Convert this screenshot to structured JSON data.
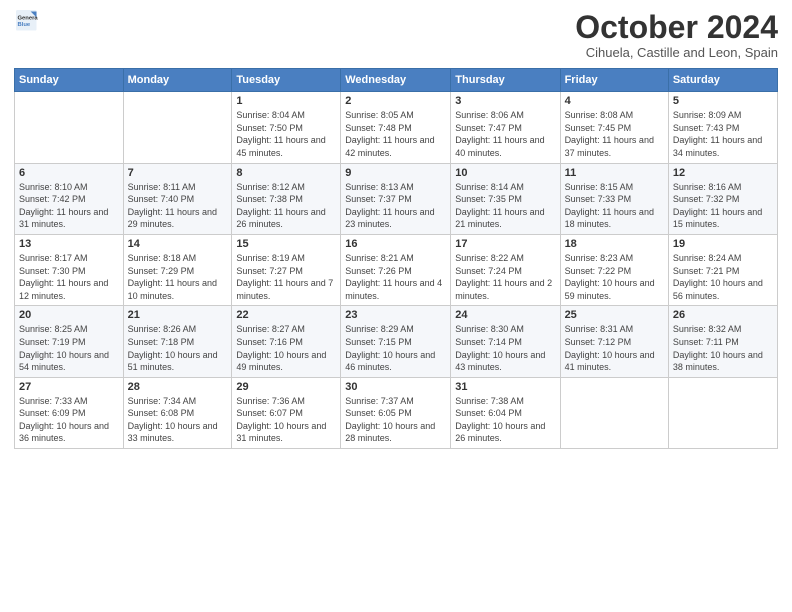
{
  "logo": {
    "general": "General",
    "blue": "Blue"
  },
  "header": {
    "month": "October 2024",
    "location": "Cihuela, Castille and Leon, Spain"
  },
  "weekdays": [
    "Sunday",
    "Monday",
    "Tuesday",
    "Wednesday",
    "Thursday",
    "Friday",
    "Saturday"
  ],
  "weeks": [
    [
      {
        "day": "",
        "info": ""
      },
      {
        "day": "",
        "info": ""
      },
      {
        "day": "1",
        "info": "Sunrise: 8:04 AM\nSunset: 7:50 PM\nDaylight: 11 hours and 45 minutes."
      },
      {
        "day": "2",
        "info": "Sunrise: 8:05 AM\nSunset: 7:48 PM\nDaylight: 11 hours and 42 minutes."
      },
      {
        "day": "3",
        "info": "Sunrise: 8:06 AM\nSunset: 7:47 PM\nDaylight: 11 hours and 40 minutes."
      },
      {
        "day": "4",
        "info": "Sunrise: 8:08 AM\nSunset: 7:45 PM\nDaylight: 11 hours and 37 minutes."
      },
      {
        "day": "5",
        "info": "Sunrise: 8:09 AM\nSunset: 7:43 PM\nDaylight: 11 hours and 34 minutes."
      }
    ],
    [
      {
        "day": "6",
        "info": "Sunrise: 8:10 AM\nSunset: 7:42 PM\nDaylight: 11 hours and 31 minutes."
      },
      {
        "day": "7",
        "info": "Sunrise: 8:11 AM\nSunset: 7:40 PM\nDaylight: 11 hours and 29 minutes."
      },
      {
        "day": "8",
        "info": "Sunrise: 8:12 AM\nSunset: 7:38 PM\nDaylight: 11 hours and 26 minutes."
      },
      {
        "day": "9",
        "info": "Sunrise: 8:13 AM\nSunset: 7:37 PM\nDaylight: 11 hours and 23 minutes."
      },
      {
        "day": "10",
        "info": "Sunrise: 8:14 AM\nSunset: 7:35 PM\nDaylight: 11 hours and 21 minutes."
      },
      {
        "day": "11",
        "info": "Sunrise: 8:15 AM\nSunset: 7:33 PM\nDaylight: 11 hours and 18 minutes."
      },
      {
        "day": "12",
        "info": "Sunrise: 8:16 AM\nSunset: 7:32 PM\nDaylight: 11 hours and 15 minutes."
      }
    ],
    [
      {
        "day": "13",
        "info": "Sunrise: 8:17 AM\nSunset: 7:30 PM\nDaylight: 11 hours and 12 minutes."
      },
      {
        "day": "14",
        "info": "Sunrise: 8:18 AM\nSunset: 7:29 PM\nDaylight: 11 hours and 10 minutes."
      },
      {
        "day": "15",
        "info": "Sunrise: 8:19 AM\nSunset: 7:27 PM\nDaylight: 11 hours and 7 minutes."
      },
      {
        "day": "16",
        "info": "Sunrise: 8:21 AM\nSunset: 7:26 PM\nDaylight: 11 hours and 4 minutes."
      },
      {
        "day": "17",
        "info": "Sunrise: 8:22 AM\nSunset: 7:24 PM\nDaylight: 11 hours and 2 minutes."
      },
      {
        "day": "18",
        "info": "Sunrise: 8:23 AM\nSunset: 7:22 PM\nDaylight: 10 hours and 59 minutes."
      },
      {
        "day": "19",
        "info": "Sunrise: 8:24 AM\nSunset: 7:21 PM\nDaylight: 10 hours and 56 minutes."
      }
    ],
    [
      {
        "day": "20",
        "info": "Sunrise: 8:25 AM\nSunset: 7:19 PM\nDaylight: 10 hours and 54 minutes."
      },
      {
        "day": "21",
        "info": "Sunrise: 8:26 AM\nSunset: 7:18 PM\nDaylight: 10 hours and 51 minutes."
      },
      {
        "day": "22",
        "info": "Sunrise: 8:27 AM\nSunset: 7:16 PM\nDaylight: 10 hours and 49 minutes."
      },
      {
        "day": "23",
        "info": "Sunrise: 8:29 AM\nSunset: 7:15 PM\nDaylight: 10 hours and 46 minutes."
      },
      {
        "day": "24",
        "info": "Sunrise: 8:30 AM\nSunset: 7:14 PM\nDaylight: 10 hours and 43 minutes."
      },
      {
        "day": "25",
        "info": "Sunrise: 8:31 AM\nSunset: 7:12 PM\nDaylight: 10 hours and 41 minutes."
      },
      {
        "day": "26",
        "info": "Sunrise: 8:32 AM\nSunset: 7:11 PM\nDaylight: 10 hours and 38 minutes."
      }
    ],
    [
      {
        "day": "27",
        "info": "Sunrise: 7:33 AM\nSunset: 6:09 PM\nDaylight: 10 hours and 36 minutes."
      },
      {
        "day": "28",
        "info": "Sunrise: 7:34 AM\nSunset: 6:08 PM\nDaylight: 10 hours and 33 minutes."
      },
      {
        "day": "29",
        "info": "Sunrise: 7:36 AM\nSunset: 6:07 PM\nDaylight: 10 hours and 31 minutes."
      },
      {
        "day": "30",
        "info": "Sunrise: 7:37 AM\nSunset: 6:05 PM\nDaylight: 10 hours and 28 minutes."
      },
      {
        "day": "31",
        "info": "Sunrise: 7:38 AM\nSunset: 6:04 PM\nDaylight: 10 hours and 26 minutes."
      },
      {
        "day": "",
        "info": ""
      },
      {
        "day": "",
        "info": ""
      }
    ]
  ]
}
